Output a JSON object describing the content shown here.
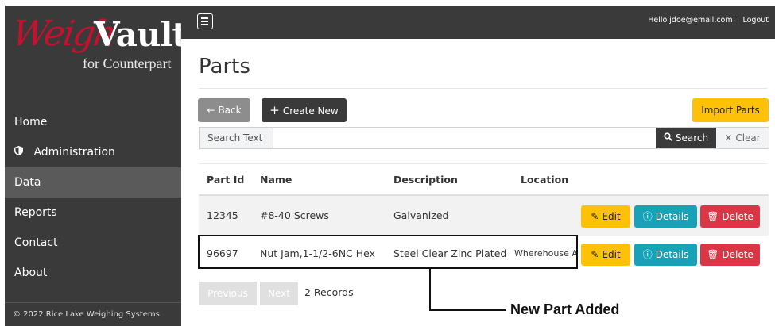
{
  "brand": {
    "name_part1": "Weigh",
    "name_part2": "Vault",
    "subtitle": "for Counterpart"
  },
  "sidebar": {
    "items": [
      {
        "label": "Home",
        "icon": "",
        "active": false
      },
      {
        "label": "Administration",
        "icon": "shield-icon",
        "active": false
      },
      {
        "label": "Data",
        "icon": "",
        "active": true
      },
      {
        "label": "Reports",
        "icon": "",
        "active": false
      },
      {
        "label": "Contact",
        "icon": "",
        "active": false
      },
      {
        "label": "About",
        "icon": "",
        "active": false
      }
    ],
    "footer": "© 2022 Rice Lake Weighing Systems"
  },
  "topbar": {
    "greeting": "Hello jdoe@email.com!",
    "logout": "Logout",
    "menu_icon": "hamburger-icon"
  },
  "page": {
    "title": "Parts"
  },
  "toolbar": {
    "back_label": "Back",
    "create_label": "Create New",
    "import_label": "Import Parts"
  },
  "search": {
    "label": "Search Text",
    "value": "",
    "search_label": "Search",
    "clear_label": "Clear"
  },
  "table": {
    "headers": {
      "part_id": "Part Id",
      "name": "Name",
      "description": "Description",
      "location": "Location"
    },
    "rows": [
      {
        "part_id": "12345",
        "name": "#8-40 Screws",
        "description": "Galvanized",
        "location": ""
      },
      {
        "part_id": "96697",
        "name": "Nut Jam,1-1/2-6NC Hex",
        "description": "Steel Clear Zinc Plated",
        "location": "Wherehouse A"
      }
    ],
    "actions": {
      "edit": "Edit",
      "details": "Details",
      "delete": "Delete"
    }
  },
  "pager": {
    "previous": "Previous",
    "next": "Next",
    "records": "2 Records"
  },
  "annotation": {
    "label": "New Part Added"
  },
  "colors": {
    "sidebar": "#3a3a3a",
    "warning": "#ffc107",
    "info": "#17a2b8",
    "danger": "#dc3545",
    "brand_red": "#c8102e"
  }
}
